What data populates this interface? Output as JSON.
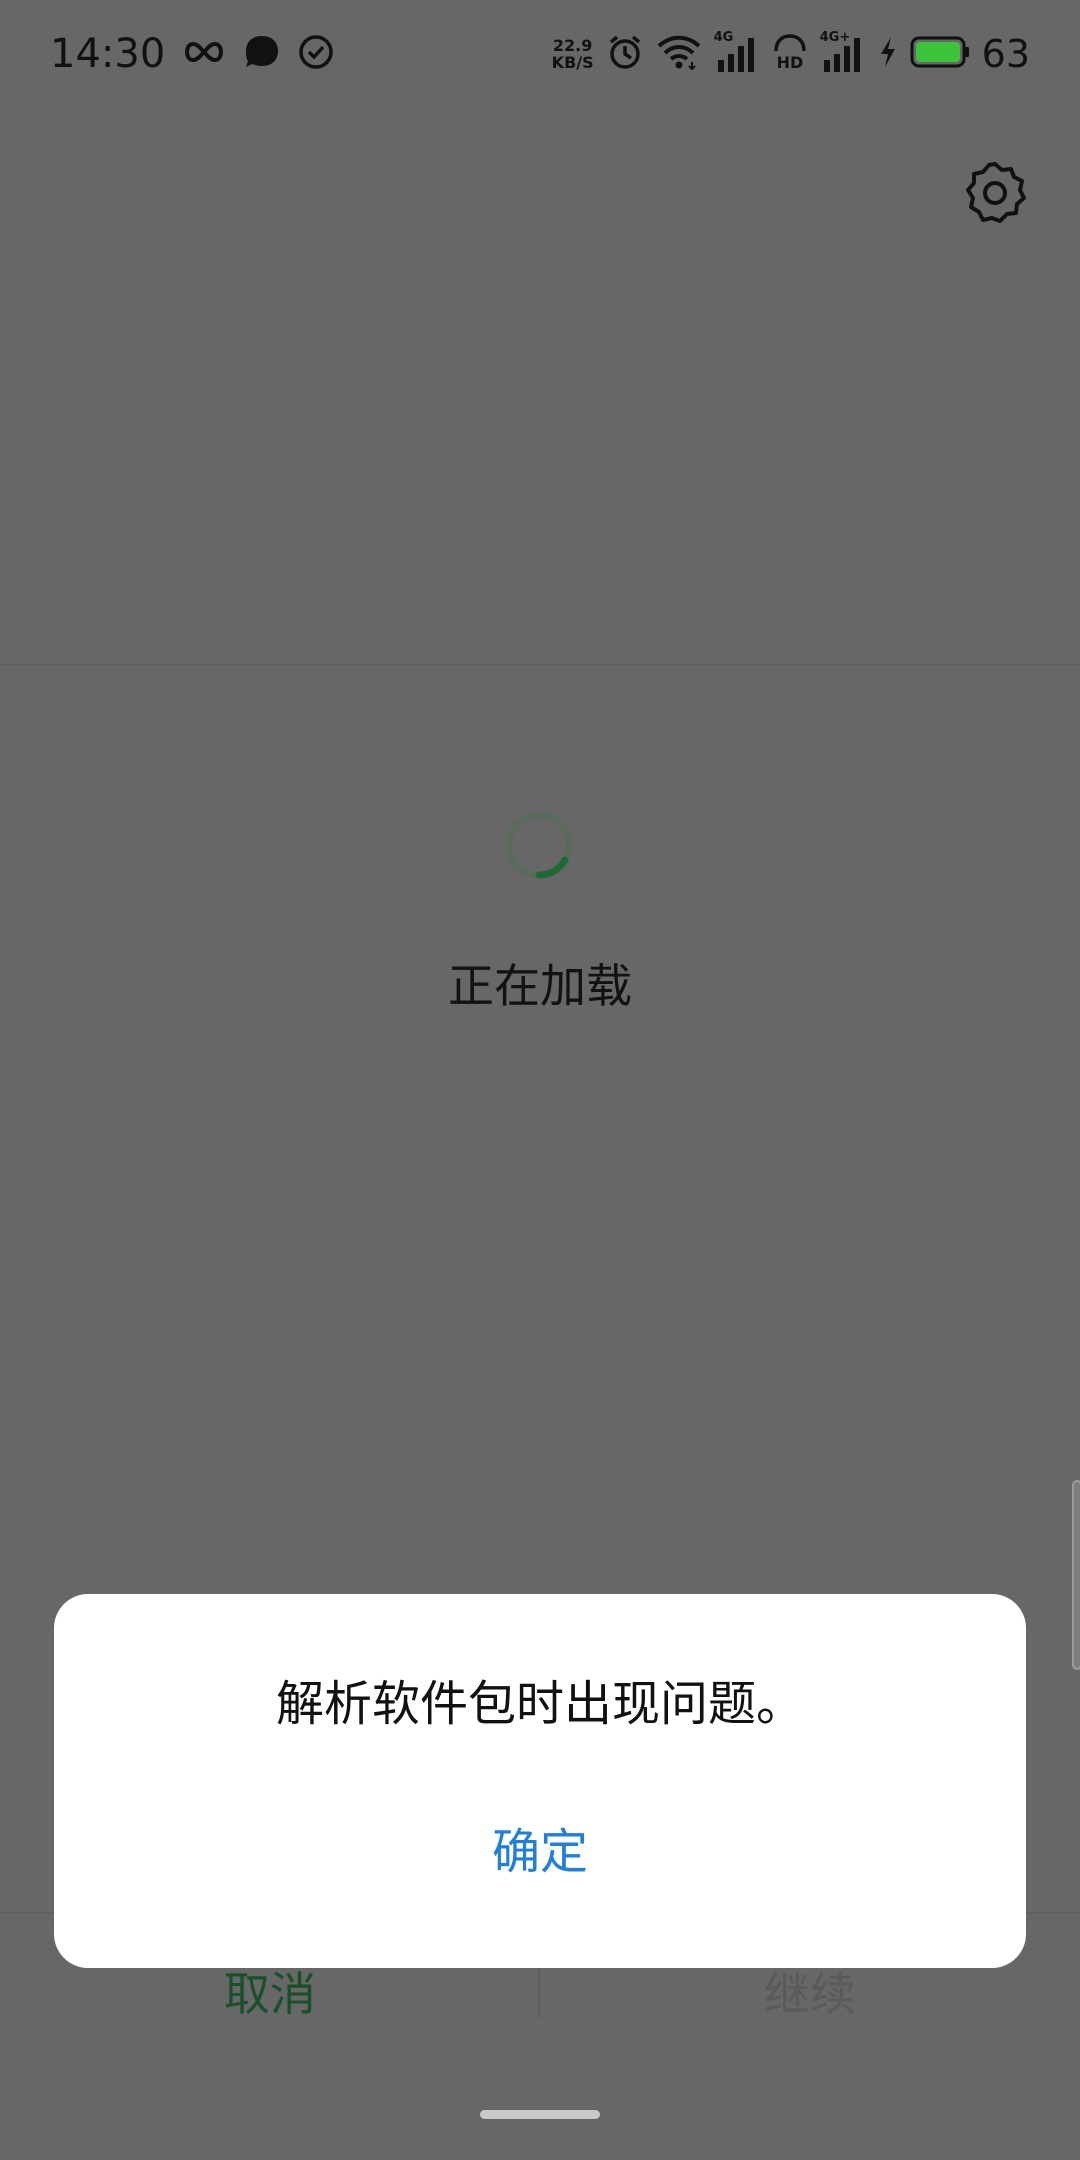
{
  "status_bar": {
    "time": "14:30",
    "net_speed_value": "22.9",
    "net_speed_unit": "KB/S",
    "signal1_label": "4G",
    "hd_label": "HD",
    "signal2_label": "4G+",
    "battery_percent": "63",
    "icons": [
      "infinity-icon",
      "bubble-icon",
      "check-circle-icon",
      "alarm-icon",
      "wifi-icon",
      "signal-icon",
      "hd-icon",
      "signal-icon",
      "charging-icon",
      "battery-icon"
    ]
  },
  "loading": {
    "text": "正在加载"
  },
  "bottom_buttons": {
    "cancel": "取消",
    "continue": "继续"
  },
  "dialog": {
    "message": "解析软件包时出现问题。",
    "ok_label": "确定"
  },
  "colors": {
    "scrim": "#676767",
    "accent_green": "#17502a",
    "dialog_button_blue": "#1f7fdc",
    "battery_green": "#3ec43a"
  }
}
